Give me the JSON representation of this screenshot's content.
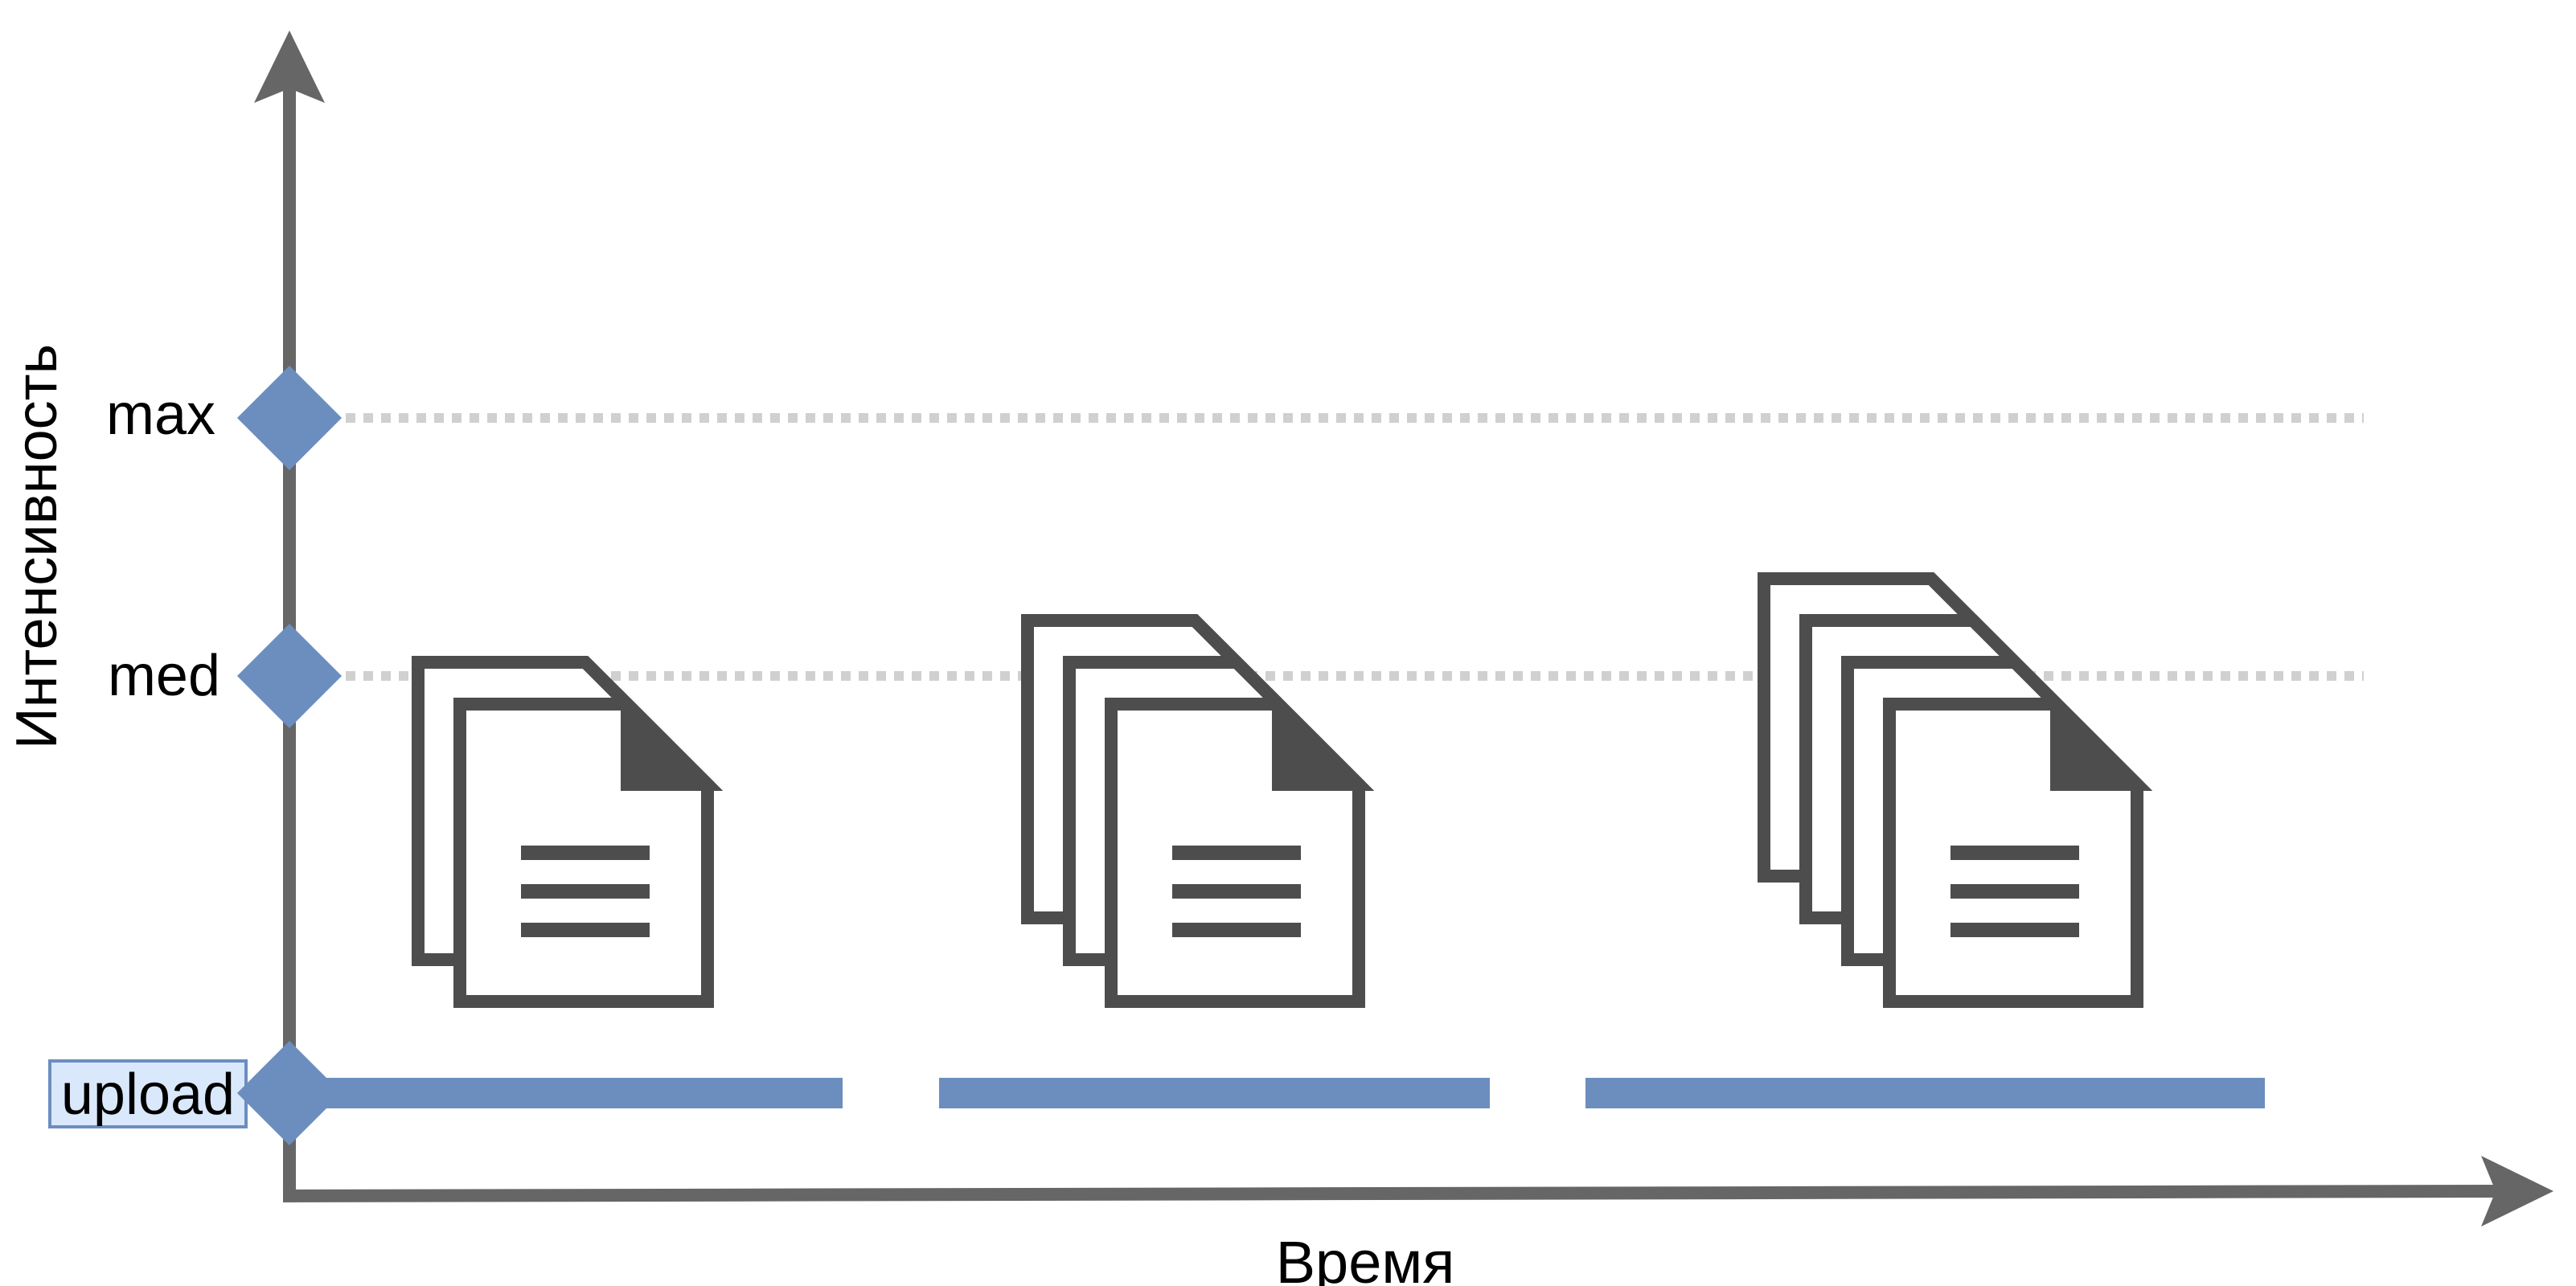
{
  "axes": {
    "y_label": "Интенсивность",
    "x_label": "Время"
  },
  "levels": {
    "max": "max",
    "med": "med",
    "upload": "upload"
  },
  "colors": {
    "axis": "#666666",
    "accent": "#6c8ebf",
    "accent_fill_light": "#dae8fc",
    "icon": "#4d4d4d",
    "grid": "#d0d0d0"
  },
  "icons": [
    "document-stack-icon",
    "document-stack-icon",
    "document-stack-icon"
  ],
  "upload_segments": 3,
  "document_stacks": [
    {
      "count": 2
    },
    {
      "count": 3
    },
    {
      "count": 4
    }
  ]
}
